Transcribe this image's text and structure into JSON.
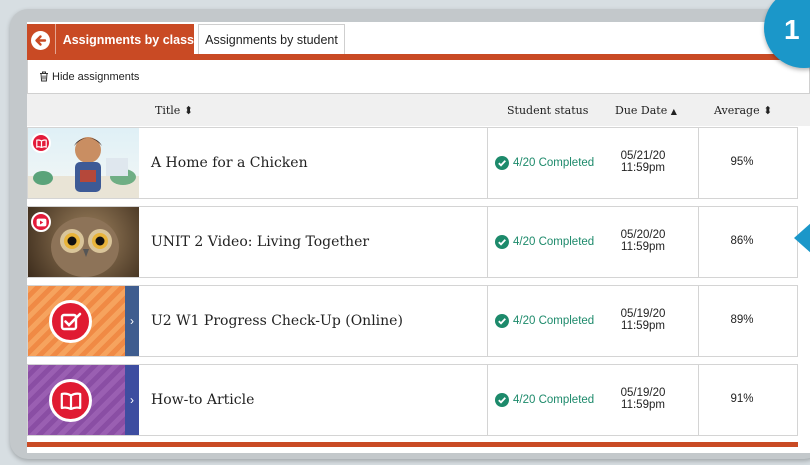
{
  "tabs": {
    "active_label": "Assignments by class",
    "inactive_label": "Assignments by student"
  },
  "toolbar": {
    "hide_label": "Hide assignments"
  },
  "table": {
    "headers": {
      "title": "Title",
      "status": "Student status",
      "due": "Due Date",
      "average": "Average"
    },
    "rows": [
      {
        "title": "A Home for a Chicken",
        "status": "4/20 Completed",
        "due_date": "05/21/20",
        "due_time": "11:59pm",
        "average": "95%",
        "thumb": "book-illustration",
        "badge": "book-icon"
      },
      {
        "title": "UNIT 2 Video: Living Together",
        "status": "4/20 Completed",
        "due_date": "05/20/20",
        "due_time": "11:59pm",
        "average": "86%",
        "thumb": "owl-photo",
        "badge": "play-icon"
      },
      {
        "title": "U2 W1 Progress Check-Up (Online)",
        "status": "4/20 Completed",
        "due_date": "05/19/20",
        "due_time": "11:59pm",
        "average": "89%",
        "thumb": "orange-pattern",
        "badge": "checkbox-icon"
      },
      {
        "title": "How-to Article",
        "status": "4/20 Completed",
        "due_date": "05/19/20",
        "due_time": "11:59pm",
        "average": "91%",
        "thumb": "purple-pattern",
        "badge": "book-icon"
      }
    ]
  },
  "callout": {
    "number": "1"
  },
  "colors": {
    "accent": "#c94a24",
    "status_green": "#1d8a6b",
    "callout_blue": "#1b97c9",
    "badge_red": "#e01b32"
  }
}
